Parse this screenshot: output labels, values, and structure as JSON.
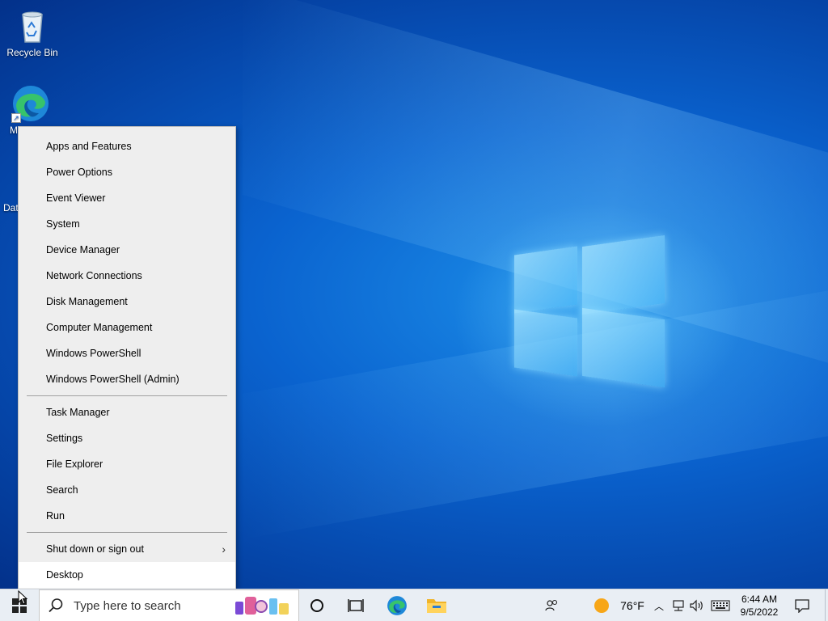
{
  "desktop": {
    "icons": [
      {
        "label": "Recycle Bin",
        "icon": "recycle-bin-icon"
      },
      {
        "label": "M",
        "icon": "edge-icon"
      },
      {
        "label": "Dat",
        "icon": "database-shortcut-icon"
      }
    ]
  },
  "context_menu": {
    "group1": [
      "Apps and Features",
      "Power Options",
      "Event Viewer",
      "System",
      "Device Manager",
      "Network Connections",
      "Disk Management",
      "Computer Management",
      "Windows PowerShell",
      "Windows PowerShell (Admin)"
    ],
    "group2": [
      "Task Manager",
      "Settings",
      "File Explorer",
      "Search",
      "Run"
    ],
    "group3": [
      {
        "label": "Shut down or sign out",
        "has_submenu": true
      },
      {
        "label": "Desktop",
        "active": true
      }
    ]
  },
  "taskbar": {
    "search_placeholder": "Type here to search",
    "weather_temp": "76°F",
    "time": "6:44 AM",
    "date": "9/5/2022",
    "icons": [
      "start-icon",
      "search-icon",
      "cortana-icon",
      "task-view-icon",
      "edge-icon",
      "file-explorer-icon",
      "people-icon",
      "weather-sun-icon",
      "show-hidden-icons-chevron",
      "network-icon",
      "volume-icon",
      "keyboard-icon",
      "notification-icon"
    ]
  },
  "colors": {
    "accent": "#0a63cf",
    "menu_bg": "#eeeeee",
    "taskbar_bg": "#e9eef4"
  }
}
